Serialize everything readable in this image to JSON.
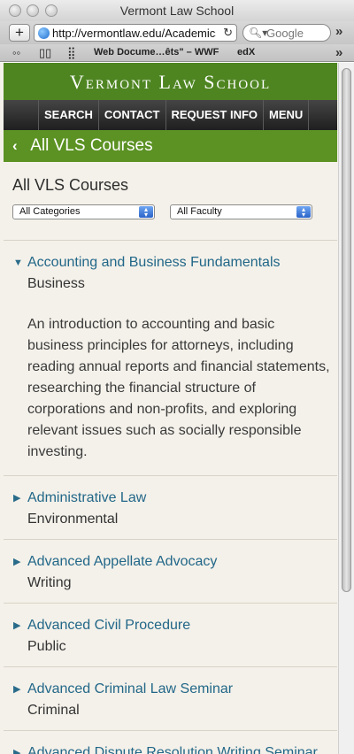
{
  "window": {
    "title": "Vermont Law School"
  },
  "toolbar": {
    "url": "http://vermontlaw.edu/Academics/Courses",
    "search_placeholder": "Google"
  },
  "bookmarks": {
    "items": [
      "Web Docume…êts\" – WWF",
      "edX"
    ]
  },
  "site": {
    "title": "Vermont Law School",
    "nav": [
      "SEARCH",
      "CONTACT",
      "REQUEST INFO",
      "MENU"
    ],
    "section": "All VLS Courses",
    "brand_color": "#4e8521"
  },
  "filters": {
    "heading": "All VLS Courses",
    "category": "All Categories",
    "faculty": "All Faculty"
  },
  "courses": [
    {
      "title": "Accounting and Business Fundamentals",
      "category": "Business",
      "expanded": true,
      "description": "An introduction to accounting and basic business principles for attorneys, including reading annual reports and financial statements, researching the financial structure of corporations and non-profits, and exploring relevant issues such as socially responsible investing."
    },
    {
      "title": "Administrative Law",
      "category": "Environmental"
    },
    {
      "title": "Advanced Appellate Advocacy",
      "category": "Writing"
    },
    {
      "title": "Advanced Civil Procedure",
      "category": "Public"
    },
    {
      "title": "Advanced Criminal Law Seminar",
      "category": "Criminal"
    },
    {
      "title": "Advanced Dispute Resolution Writing Seminar",
      "category": ""
    }
  ],
  "icons": {
    "expanded": "triangle-down",
    "collapsed": "triangle-right",
    "back": "chevron-left"
  }
}
